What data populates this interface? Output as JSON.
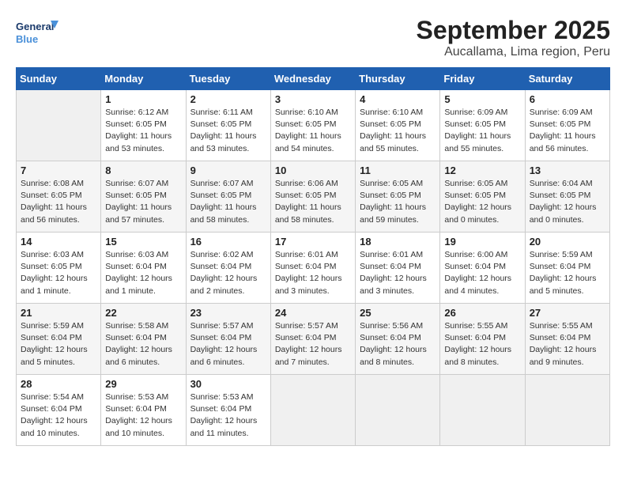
{
  "header": {
    "logo_general": "General",
    "logo_blue": "Blue",
    "month": "September 2025",
    "location": "Aucallama, Lima region, Peru"
  },
  "columns": [
    "Sunday",
    "Monday",
    "Tuesday",
    "Wednesday",
    "Thursday",
    "Friday",
    "Saturday"
  ],
  "weeks": [
    [
      {
        "day": "",
        "info": ""
      },
      {
        "day": "1",
        "info": "Sunrise: 6:12 AM\nSunset: 6:05 PM\nDaylight: 11 hours\nand 53 minutes."
      },
      {
        "day": "2",
        "info": "Sunrise: 6:11 AM\nSunset: 6:05 PM\nDaylight: 11 hours\nand 53 minutes."
      },
      {
        "day": "3",
        "info": "Sunrise: 6:10 AM\nSunset: 6:05 PM\nDaylight: 11 hours\nand 54 minutes."
      },
      {
        "day": "4",
        "info": "Sunrise: 6:10 AM\nSunset: 6:05 PM\nDaylight: 11 hours\nand 55 minutes."
      },
      {
        "day": "5",
        "info": "Sunrise: 6:09 AM\nSunset: 6:05 PM\nDaylight: 11 hours\nand 55 minutes."
      },
      {
        "day": "6",
        "info": "Sunrise: 6:09 AM\nSunset: 6:05 PM\nDaylight: 11 hours\nand 56 minutes."
      }
    ],
    [
      {
        "day": "7",
        "info": "Sunrise: 6:08 AM\nSunset: 6:05 PM\nDaylight: 11 hours\nand 56 minutes."
      },
      {
        "day": "8",
        "info": "Sunrise: 6:07 AM\nSunset: 6:05 PM\nDaylight: 11 hours\nand 57 minutes."
      },
      {
        "day": "9",
        "info": "Sunrise: 6:07 AM\nSunset: 6:05 PM\nDaylight: 11 hours\nand 58 minutes."
      },
      {
        "day": "10",
        "info": "Sunrise: 6:06 AM\nSunset: 6:05 PM\nDaylight: 11 hours\nand 58 minutes."
      },
      {
        "day": "11",
        "info": "Sunrise: 6:05 AM\nSunset: 6:05 PM\nDaylight: 11 hours\nand 59 minutes."
      },
      {
        "day": "12",
        "info": "Sunrise: 6:05 AM\nSunset: 6:05 PM\nDaylight: 12 hours\nand 0 minutes."
      },
      {
        "day": "13",
        "info": "Sunrise: 6:04 AM\nSunset: 6:05 PM\nDaylight: 12 hours\nand 0 minutes."
      }
    ],
    [
      {
        "day": "14",
        "info": "Sunrise: 6:03 AM\nSunset: 6:05 PM\nDaylight: 12 hours\nand 1 minute."
      },
      {
        "day": "15",
        "info": "Sunrise: 6:03 AM\nSunset: 6:04 PM\nDaylight: 12 hours\nand 1 minute."
      },
      {
        "day": "16",
        "info": "Sunrise: 6:02 AM\nSunset: 6:04 PM\nDaylight: 12 hours\nand 2 minutes."
      },
      {
        "day": "17",
        "info": "Sunrise: 6:01 AM\nSunset: 6:04 PM\nDaylight: 12 hours\nand 3 minutes."
      },
      {
        "day": "18",
        "info": "Sunrise: 6:01 AM\nSunset: 6:04 PM\nDaylight: 12 hours\nand 3 minutes."
      },
      {
        "day": "19",
        "info": "Sunrise: 6:00 AM\nSunset: 6:04 PM\nDaylight: 12 hours\nand 4 minutes."
      },
      {
        "day": "20",
        "info": "Sunrise: 5:59 AM\nSunset: 6:04 PM\nDaylight: 12 hours\nand 5 minutes."
      }
    ],
    [
      {
        "day": "21",
        "info": "Sunrise: 5:59 AM\nSunset: 6:04 PM\nDaylight: 12 hours\nand 5 minutes."
      },
      {
        "day": "22",
        "info": "Sunrise: 5:58 AM\nSunset: 6:04 PM\nDaylight: 12 hours\nand 6 minutes."
      },
      {
        "day": "23",
        "info": "Sunrise: 5:57 AM\nSunset: 6:04 PM\nDaylight: 12 hours\nand 6 minutes."
      },
      {
        "day": "24",
        "info": "Sunrise: 5:57 AM\nSunset: 6:04 PM\nDaylight: 12 hours\nand 7 minutes."
      },
      {
        "day": "25",
        "info": "Sunrise: 5:56 AM\nSunset: 6:04 PM\nDaylight: 12 hours\nand 8 minutes."
      },
      {
        "day": "26",
        "info": "Sunrise: 5:55 AM\nSunset: 6:04 PM\nDaylight: 12 hours\nand 8 minutes."
      },
      {
        "day": "27",
        "info": "Sunrise: 5:55 AM\nSunset: 6:04 PM\nDaylight: 12 hours\nand 9 minutes."
      }
    ],
    [
      {
        "day": "28",
        "info": "Sunrise: 5:54 AM\nSunset: 6:04 PM\nDaylight: 12 hours\nand 10 minutes."
      },
      {
        "day": "29",
        "info": "Sunrise: 5:53 AM\nSunset: 6:04 PM\nDaylight: 12 hours\nand 10 minutes."
      },
      {
        "day": "30",
        "info": "Sunrise: 5:53 AM\nSunset: 6:04 PM\nDaylight: 12 hours\nand 11 minutes."
      },
      {
        "day": "",
        "info": ""
      },
      {
        "day": "",
        "info": ""
      },
      {
        "day": "",
        "info": ""
      },
      {
        "day": "",
        "info": ""
      }
    ]
  ]
}
